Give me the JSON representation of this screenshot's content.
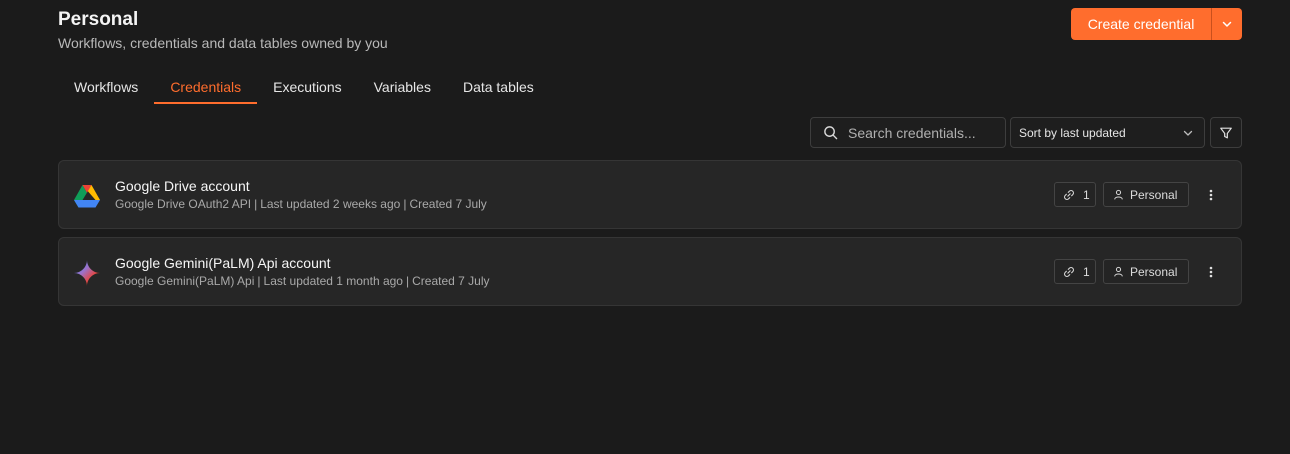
{
  "header": {
    "title": "Personal",
    "subtitle": "Workflows, credentials and data tables owned by you",
    "create_label": "Create credential"
  },
  "tabs": [
    {
      "label": "Workflows"
    },
    {
      "label": "Credentials",
      "active": true
    },
    {
      "label": "Executions"
    },
    {
      "label": "Variables"
    },
    {
      "label": "Data tables"
    }
  ],
  "toolbar": {
    "search_placeholder": "Search credentials...",
    "sort_value": "Sort by last updated"
  },
  "credentials": [
    {
      "name": "Google Drive account",
      "type": "Google Drive OAuth2 API",
      "updated": "Last updated 2 weeks ago",
      "created": "Created 7 July",
      "links": "1",
      "project": "Personal",
      "icon": "google-drive-icon"
    },
    {
      "name": "Google Gemini(PaLM) Api account",
      "type": "Google Gemini(PaLM) Api",
      "updated": "Last updated 1 month ago",
      "created": "Created 7 July",
      "links": "1",
      "project": "Personal",
      "icon": "gemini-icon"
    }
  ],
  "colors": {
    "accent": "#ff6d2d",
    "background": "#1b1b1b",
    "card": "#262626"
  }
}
